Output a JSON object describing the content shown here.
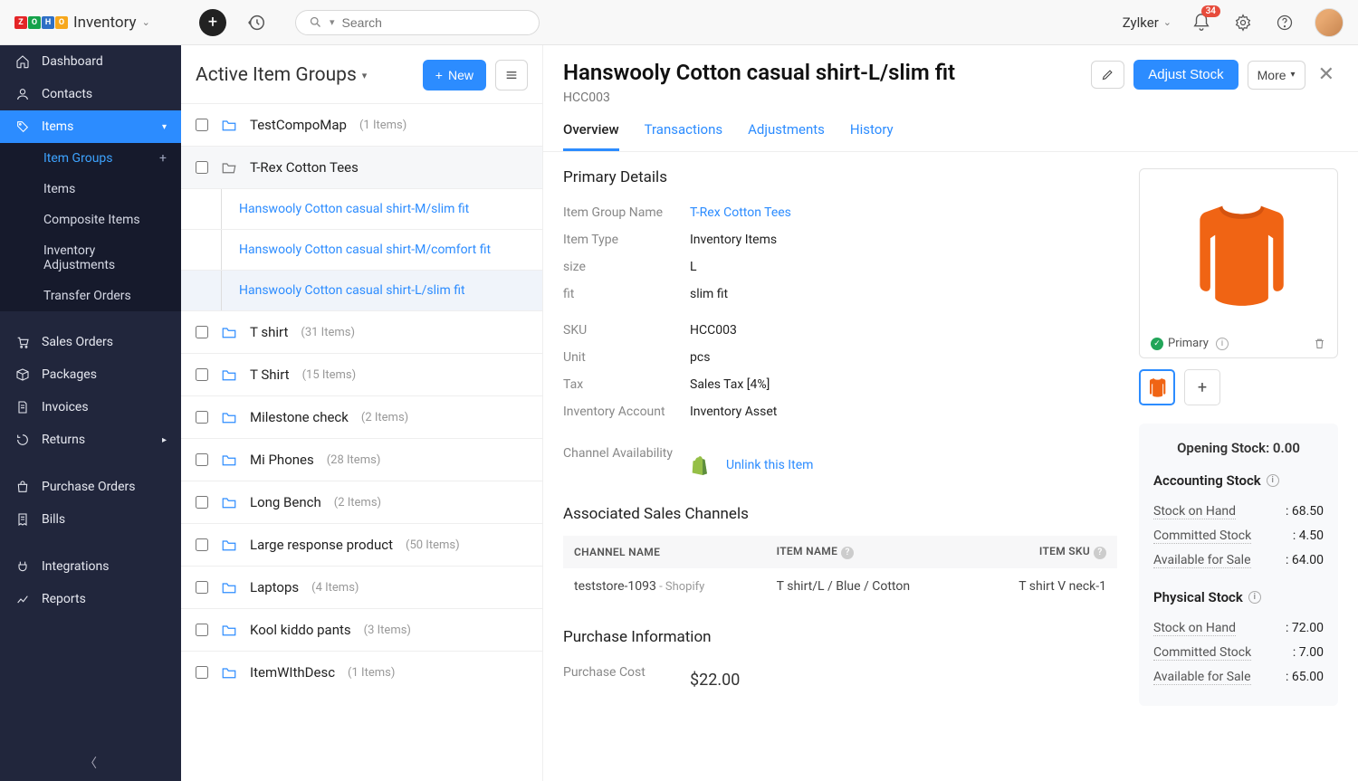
{
  "brand": {
    "product": "Inventory"
  },
  "topbar": {
    "search_placeholder": "Search",
    "org_name": "Zylker",
    "notification_count": "34"
  },
  "sidebar": {
    "items": [
      {
        "label": "Dashboard"
      },
      {
        "label": "Contacts"
      },
      {
        "label": "Items"
      },
      {
        "label": "Sales Orders"
      },
      {
        "label": "Packages"
      },
      {
        "label": "Invoices"
      },
      {
        "label": "Returns"
      },
      {
        "label": "Purchase Orders"
      },
      {
        "label": "Bills"
      },
      {
        "label": "Integrations"
      },
      {
        "label": "Reports"
      }
    ],
    "items_sub": [
      {
        "label": "Item Groups"
      },
      {
        "label": "Items"
      },
      {
        "label": "Composite Items"
      },
      {
        "label": "Inventory Adjustments"
      },
      {
        "label": "Transfer Orders"
      }
    ]
  },
  "mid": {
    "title": "Active Item Groups",
    "new_label": "New",
    "groups": [
      {
        "name": "TestCompoMap",
        "count": "(1 Items)"
      },
      {
        "name": "T-Rex Cotton Tees",
        "count": ""
      },
      {
        "name": "T shirt",
        "count": "(31 Items)"
      },
      {
        "name": "T Shirt",
        "count": "(15 Items)"
      },
      {
        "name": "Milestone check",
        "count": "(2 Items)"
      },
      {
        "name": "Mi Phones",
        "count": "(28 Items)"
      },
      {
        "name": "Long Bench",
        "count": "(2 Items)"
      },
      {
        "name": "Large response product",
        "count": "(50 Items)"
      },
      {
        "name": "Laptops",
        "count": "(4 Items)"
      },
      {
        "name": "Kool kiddo pants",
        "count": "(3 Items)"
      },
      {
        "name": "ItemWIthDesc",
        "count": "(1 Items)"
      }
    ],
    "children": [
      {
        "name": "Hanswooly Cotton casual shirt-M/slim fit"
      },
      {
        "name": "Hanswooly Cotton casual shirt-M/comfort fit"
      },
      {
        "name": "Hanswooly Cotton casual shirt-L/slim fit"
      }
    ]
  },
  "detail": {
    "title": "Hanswooly Cotton casual shirt-L/slim fit",
    "sku": "HCC003",
    "adjust_label": "Adjust Stock",
    "more_label": "More",
    "tabs": [
      "Overview",
      "Transactions",
      "Adjustments",
      "History"
    ],
    "primary_title": "Primary Details",
    "fields": {
      "item_group_label": "Item Group Name",
      "item_group_val": "T-Rex Cotton Tees",
      "item_type_label": "Item Type",
      "item_type_val": "Inventory Items",
      "size_label": "size",
      "size_val": "L",
      "fit_label": "fit",
      "fit_val": "slim fit",
      "sku_label": "SKU",
      "sku_val": "HCC003",
      "unit_label": "Unit",
      "unit_val": "pcs",
      "tax_label": "Tax",
      "tax_val": "Sales Tax [4%]",
      "inv_acct_label": "Inventory Account",
      "inv_acct_val": "Inventory Asset",
      "channel_label": "Channel Availability",
      "channel_action": "Unlink this Item"
    },
    "assoc_title": "Associated Sales Channels",
    "assoc_headers": {
      "c1": "CHANNEL NAME",
      "c2": "ITEM NAME",
      "c3": "ITEM SKU"
    },
    "assoc_row": {
      "store": "teststore-1093",
      "platform": " - Shopify",
      "item": "T shirt/L / Blue / Cotton",
      "sku": "T shirt V neck-1"
    },
    "purchase_title": "Purchase Information",
    "purchase_cost_label": "Purchase Cost",
    "purchase_cost_val": "$22.00",
    "img": {
      "primary_label": "Primary"
    },
    "stock": {
      "opening": "Opening Stock: 0.00",
      "acct_title": "Accounting Stock",
      "phys_title": "Physical Stock",
      "rows": [
        {
          "l": "Stock on Hand",
          "v": ": 68.50"
        },
        {
          "l": "Committed Stock",
          "v": ": 4.50"
        },
        {
          "l": "Available for Sale",
          "v": ": 64.00"
        }
      ],
      "prows": [
        {
          "l": "Stock on Hand",
          "v": ": 72.00"
        },
        {
          "l": "Committed Stock",
          "v": ": 7.00"
        },
        {
          "l": "Available for Sale",
          "v": ": 65.00"
        }
      ]
    }
  }
}
